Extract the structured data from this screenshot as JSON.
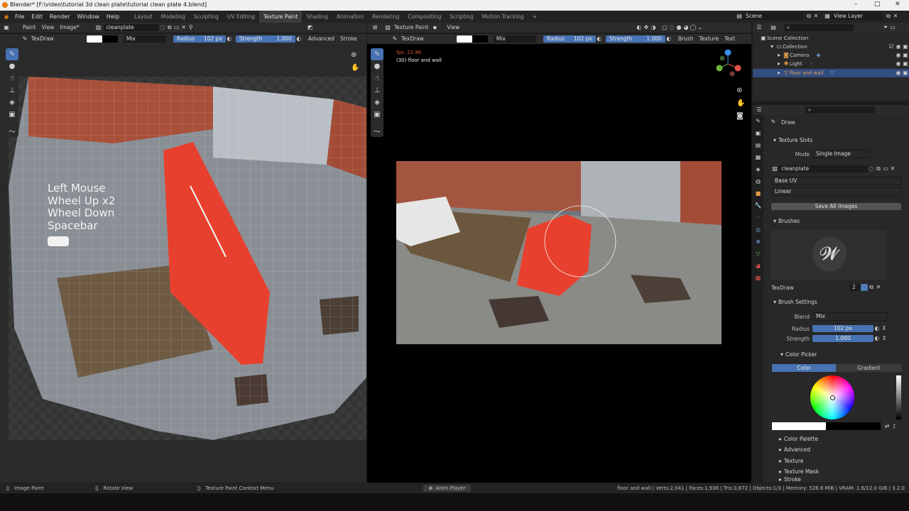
{
  "window": {
    "title": "Blender* [F:\\video\\tutorial 3d clean plate\\tutorial clean plate 4.blend]",
    "controls": {
      "minimize": "–",
      "maximize": "□",
      "close": "✕"
    }
  },
  "menubar": {
    "items": [
      "File",
      "Edit",
      "Render",
      "Window",
      "Help"
    ],
    "workspaces": [
      "Layout",
      "Modeling",
      "Sculpting",
      "UV Editing",
      "Texture Paint",
      "Shading",
      "Animation",
      "Rendering",
      "Compositing",
      "Scripting",
      "Motion Tracking"
    ],
    "active_workspace": "Texture Paint",
    "add_tab": "+",
    "scene": "Scene",
    "view_layer": "View Layer"
  },
  "image_editor": {
    "mode": "Paint",
    "menus": [
      "View",
      "Image*"
    ],
    "image_name": "cleanplate",
    "tool_brush": "TexDraw",
    "blend": "Mix",
    "radius_label": "Radius",
    "radius_value": "102 px",
    "strength_label": "Strength",
    "strength_value": "1.000",
    "advanced": "Advanced",
    "stroke": "Stroke",
    "overlay_lines": [
      "Left Mouse",
      "Wheel Up x2",
      "Wheel Down",
      "Spacebar"
    ]
  },
  "viewport": {
    "mode": "Texture Paint",
    "menu": "View",
    "tool_brush": "TexDraw",
    "blend": "Mix",
    "radius_label": "Radius",
    "radius_value": "102 px",
    "strength_label": "Strength",
    "strength_value": "1.000",
    "brush_menu": "Brush",
    "texture_menu": "Texture",
    "texture_short": "Text",
    "fps": "fps: 22.96",
    "object_info": "(30) floor and wall"
  },
  "outliner": {
    "search_placeholder": "",
    "root": "Scene Collection",
    "items": [
      {
        "label": "Collection"
      },
      {
        "label": "Camera"
      },
      {
        "label": "Light"
      },
      {
        "label": "floor and wall"
      }
    ]
  },
  "properties": {
    "brush_name": "Draw",
    "texture_slots": {
      "title": "Texture Slots",
      "mode_label": "Mode",
      "mode_value": "Single Image",
      "image": "cleanplate",
      "uv": "Base UV",
      "interp": "Linear",
      "save_button": "Save All Images"
    },
    "brushes": {
      "title": "Brushes",
      "brush": "TexDraw",
      "users": "2"
    },
    "brush_settings": {
      "title": "Brush Settings",
      "blend_label": "Blend",
      "blend_value": "Mix",
      "radius_label": "Radius",
      "radius_value": "102 px",
      "strength_label": "Strength",
      "strength_value": "1.000"
    },
    "color_picker": {
      "title": "Color Picker",
      "tab_color": "Color",
      "tab_gradient": "Gradient"
    },
    "subpanels": [
      "Color Palette",
      "Advanced",
      "Texture",
      "Texture Mask",
      "Stroke"
    ]
  },
  "statusbar": {
    "left": [
      "Image Paint",
      "Rotate View",
      "Texture Paint Context Menu"
    ],
    "center": "Anim Player",
    "right": "floor and wall | Verts:2,041 | Faces:1,936 | Tris:3,872 | Objects:1/3 | Memory: 526.8 MiB | VRAM: 1.6/12.0 GiB | 3.2.0"
  },
  "colors": {
    "accent": "#4772b3",
    "barrier": "#e8402e",
    "panel_bg": "#282828",
    "header_bg": "#2b2b2b"
  }
}
